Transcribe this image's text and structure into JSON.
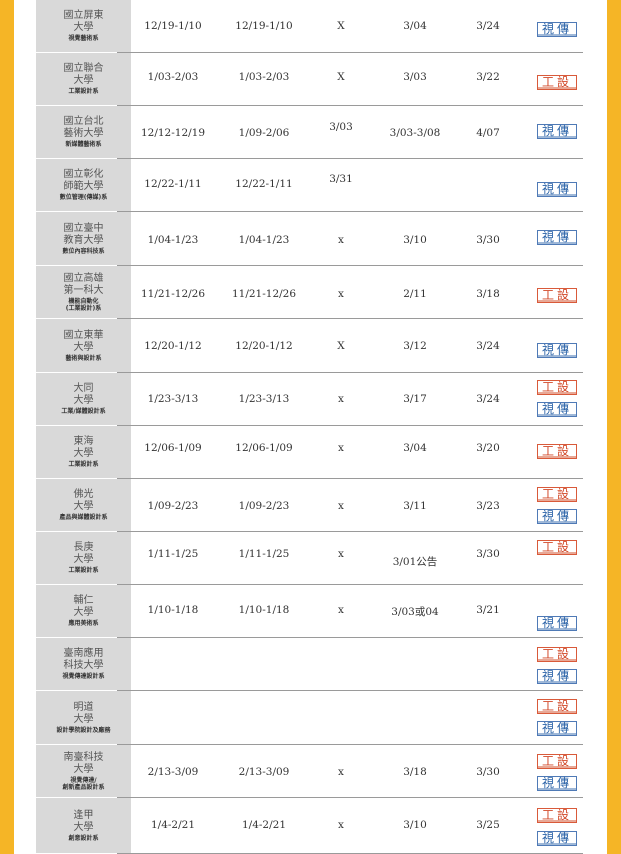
{
  "rows": [
    {
      "school": "國立屏東\n大學",
      "dept": "視覺藝術系",
      "d1": "12/19-1/10",
      "d2": "12/19-1/10",
      "d3": "X",
      "d4": "3/04",
      "d5": "3/24",
      "badges": [
        {
          "type": "vis",
          "label": "視傳"
        }
      ]
    },
    {
      "school": "國立聯合\n大學",
      "dept": "工業設計系",
      "d1": "1/03-2/03",
      "d2": "1/03-2/03",
      "d3": "X",
      "d4": "3/03",
      "d5": "3/22",
      "badges": [
        {
          "type": "ind",
          "label": "工設"
        }
      ]
    },
    {
      "school": "國立台北\n藝術大學",
      "dept": "新媒體藝術系",
      "d1": "12/12-12/19",
      "d2": "1/09-2/06",
      "d3": "3/03",
      "d4": "3/03-3/08",
      "d5": "4/07",
      "badges": [
        {
          "type": "vis",
          "label": "視傳"
        }
      ]
    },
    {
      "school": "國立彰化\n師範大學",
      "dept": "數位管理(傳媒)系",
      "d1": "12/22-1/11",
      "d2": "12/22-1/11",
      "d3": "3/31",
      "d4": "",
      "d5": "",
      "badges": [
        {
          "type": "vis",
          "label": "視傳"
        }
      ]
    },
    {
      "school": "國立臺中\n教育大學",
      "dept": "數位內容科技系",
      "d1": "1/04-1/23",
      "d2": "1/04-1/23",
      "d3": "x",
      "d4": "3/10",
      "d5": "3/30",
      "badges": [
        {
          "type": "vis",
          "label": "視傳"
        }
      ]
    },
    {
      "school": "國立高雄\n第一科大",
      "dept": "機能自動化\n(工業設計)系",
      "d1": "11/21-12/26",
      "d2": "11/21-12/26",
      "d3": "x",
      "d4": "2/11",
      "d5": "3/18",
      "badges": [
        {
          "type": "ind",
          "label": "工設"
        }
      ]
    },
    {
      "school": "國立東華\n大學",
      "dept": "藝術與設計系",
      "d1": "12/20-1/12",
      "d2": "12/20-1/12",
      "d3": "X",
      "d4": "3/12",
      "d5": "3/24",
      "badges": [
        {
          "type": "vis",
          "label": "視傳"
        }
      ]
    },
    {
      "school": "大同\n大學",
      "dept": "工業/媒體設計系",
      "d1": "1/23-3/13",
      "d2": "1/23-3/13",
      "d3": "x",
      "d4": "3/17",
      "d5": "3/24",
      "badges": [
        {
          "type": "ind",
          "label": "工設"
        },
        {
          "type": "vis",
          "label": "視傳"
        }
      ]
    },
    {
      "school": "東海\n大學",
      "dept": "工業設計系",
      "d1": "12/06-1/09",
      "d2": "12/06-1/09",
      "d3": "x",
      "d4": "3/04",
      "d5": "3/20",
      "badges": [
        {
          "type": "ind",
          "label": "工設"
        }
      ]
    },
    {
      "school": "佛光\n大學",
      "dept": "產品與媒體設計系",
      "d1": "1/09-2/23",
      "d2": "1/09-2/23",
      "d3": "x",
      "d4": "3/11",
      "d5": "3/23",
      "badges": [
        {
          "type": "ind",
          "label": "工設"
        },
        {
          "type": "vis",
          "label": "視傳"
        }
      ]
    },
    {
      "school": "長庚\n大學",
      "dept": "工業設計系",
      "d1": "1/11-1/25",
      "d2": "1/11-1/25",
      "d3": "x",
      "d4": "3/01公告",
      "d5": "3/30",
      "badges": [
        {
          "type": "ind",
          "label": "工設"
        }
      ]
    },
    {
      "school": "輔仁\n大學",
      "dept": "應用美術系",
      "d1": "1/10-1/18",
      "d2": "1/10-1/18",
      "d3": "x",
      "d4": "3/03或04",
      "d5": "3/21",
      "badges": [
        {
          "type": "vis",
          "label": "視傳"
        }
      ]
    },
    {
      "school": "臺南應用\n科技大學",
      "dept": "視覺傳達設計系",
      "d1": "",
      "d2": "",
      "d3": "",
      "d4": "",
      "d5": "",
      "badges": [
        {
          "type": "ind",
          "label": "工設"
        },
        {
          "type": "vis",
          "label": "視傳"
        }
      ]
    },
    {
      "school": "明道\n大學",
      "dept": "設計學院設計及廠務",
      "d1": "",
      "d2": "",
      "d3": "",
      "d4": "",
      "d5": "",
      "badges": [
        {
          "type": "ind",
          "label": "工設"
        },
        {
          "type": "vis",
          "label": "視傳"
        }
      ]
    },
    {
      "school": "南臺科技\n大學",
      "dept": "視覺傳達/\n創新產品設計系",
      "d1": "2/13-3/09",
      "d2": "2/13-3/09",
      "d3": "x",
      "d4": "3/18",
      "d5": "3/30",
      "badges": [
        {
          "type": "ind",
          "label": "工設"
        },
        {
          "type": "vis",
          "label": "視傳"
        }
      ]
    },
    {
      "school": "逢甲\n大學",
      "dept": "創意設計系",
      "d1": "1/4-2/21",
      "d2": "1/4-2/21",
      "d3": "x",
      "d4": "3/10",
      "d5": "3/25",
      "badges": [
        {
          "type": "ind",
          "label": "工設"
        },
        {
          "type": "vis",
          "label": "視傳"
        }
      ]
    }
  ]
}
